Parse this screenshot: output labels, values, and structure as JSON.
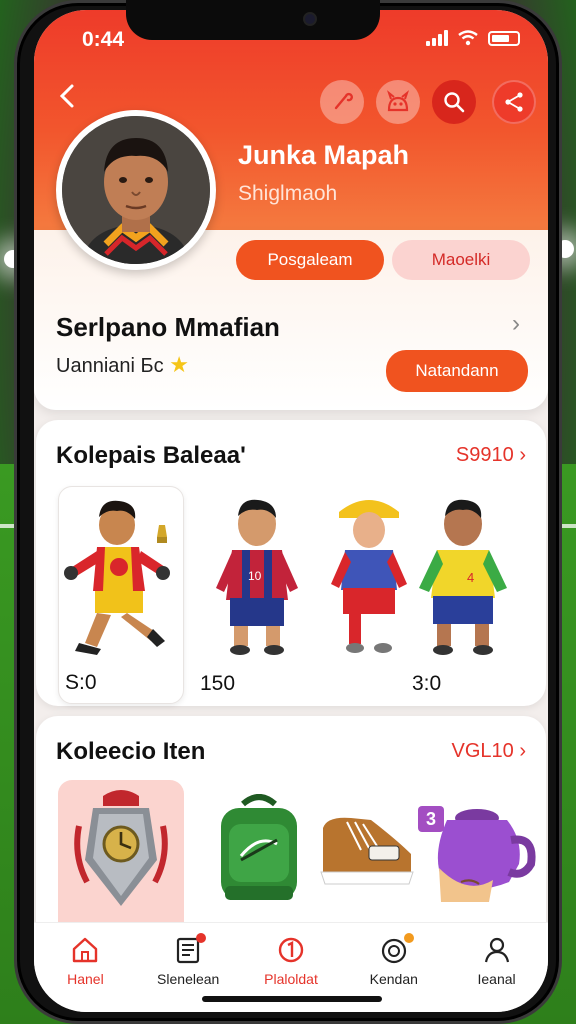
{
  "status": {
    "time": "0:44"
  },
  "profile": {
    "name": "Junka Mapah",
    "handle": "Shiglmaoh",
    "primary_button": "Posgaleam",
    "secondary_button": "Maoelki"
  },
  "team": {
    "title": "Serlpano Mmafian",
    "subtitle": "Uanniani Бс",
    "action_button": "Natandann"
  },
  "collection_players": {
    "title": "Kolepais Baleaa'",
    "link": "S9910",
    "items": [
      {
        "price": "S:0"
      },
      {
        "price": "150"
      },
      {
        "price": ""
      },
      {
        "price": "3:0"
      }
    ]
  },
  "collection_items": {
    "title": "Koleecio Iten",
    "link": "VGL10",
    "badge": "3"
  },
  "nav": [
    {
      "label": "Hanel",
      "icon": "home-icon",
      "active": true
    },
    {
      "label": "Slenelean",
      "icon": "document-icon",
      "active": false
    },
    {
      "label": "Plaloldat",
      "icon": "shield-icon",
      "active": true
    },
    {
      "label": "Kendan",
      "icon": "gauge-icon",
      "active": false
    },
    {
      "label": "Ieanal",
      "icon": "profile-icon",
      "active": false
    }
  ],
  "colors": {
    "accent": "#f0531f",
    "brand_red": "#e5332a",
    "header_top": "#ee3b2a"
  }
}
